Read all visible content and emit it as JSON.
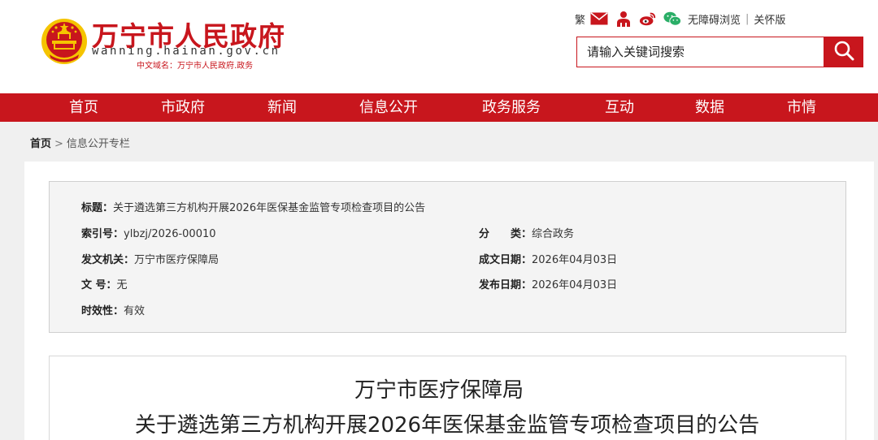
{
  "header": {
    "site_title": "万宁市人民政府",
    "site_domain": "wanning.hainan.gov.cn",
    "site_cn_domain": "中文域名：万宁市人民政府.政务",
    "utility": {
      "traditional_label": "繁",
      "accessibility_label": "无障碍浏览",
      "separator": "|",
      "elder_label": "关怀版",
      "icons": [
        "mail-icon",
        "user-icon",
        "weibo-icon",
        "wechat-icon"
      ]
    },
    "search": {
      "placeholder": "请输入关键词搜索"
    }
  },
  "nav": {
    "items": [
      "首页",
      "市政府",
      "新闻",
      "信息公开",
      "政务服务",
      "互动",
      "数据",
      "市情"
    ]
  },
  "breadcrumb": {
    "home": "首页",
    "separator": ">",
    "current": "信息公开专栏"
  },
  "meta": {
    "title_label": "标题：",
    "title_value": "关于遴选第三方机构开展2026年医保基金监管专项检查项目的公告",
    "index_label": "索引号：",
    "index_value": "ylbzj/2026-00010",
    "category_label": "分　　类：",
    "category_value": "综合政务",
    "issuer_label": "发文机关：",
    "issuer_value": "万宁市医疗保障局",
    "created_label": "成文日期：",
    "created_value": "2026年04月03日",
    "docno_label": "文  号：",
    "docno_value": "无",
    "published_label": "发布日期：",
    "published_value": "2026年04月03日",
    "validity_label": "时效性：",
    "validity_value": "有效"
  },
  "article": {
    "title_line1": "万宁市医疗保障局",
    "title_line2": "关于遴选第三方机构开展2026年医保基金监管专项检查项目的公告"
  },
  "colors": {
    "brand_red": "#c8161d",
    "emblem_gold": "#f5c400"
  }
}
